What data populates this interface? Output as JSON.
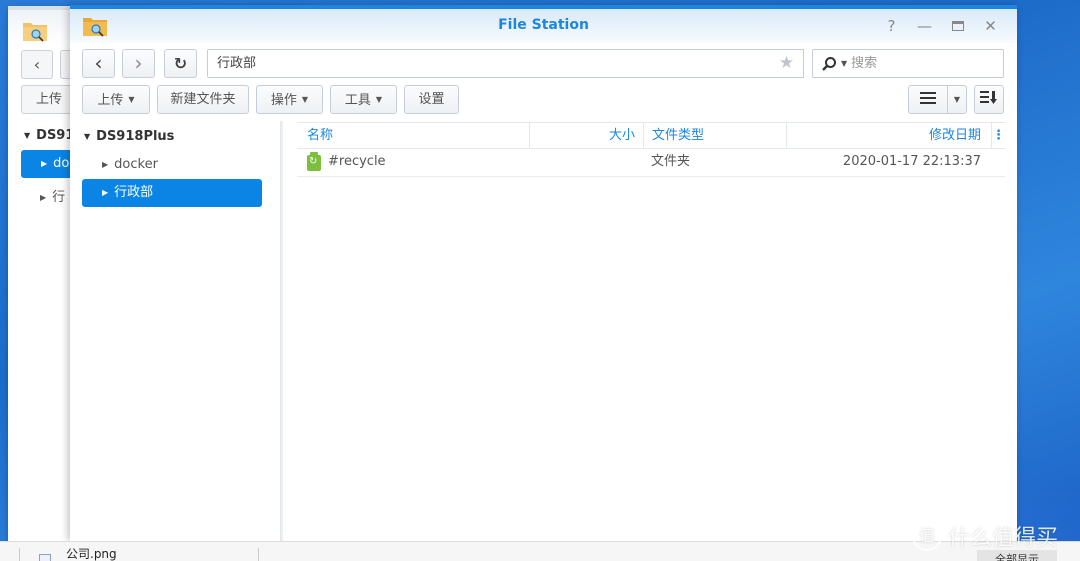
{
  "background_window": {
    "upload_label": "上传",
    "tree_root": "DS91",
    "selected_item": "do",
    "item": "行"
  },
  "window": {
    "title": "File Station",
    "controls": {
      "help": "?",
      "minimize": "—",
      "maximize": "▭",
      "close": "✕"
    }
  },
  "navigation": {
    "back": "‹",
    "forward": "›",
    "refresh": "↻",
    "path": "行政部",
    "favorite": "★",
    "search_placeholder": "搜索"
  },
  "toolbar": {
    "upload": "上传",
    "new_folder": "新建文件夹",
    "action": "操作",
    "tools": "工具",
    "settings": "设置",
    "view_list": "≡",
    "view_dropdown": "▾",
    "sort": "☰↓"
  },
  "sidebar": {
    "root": "DS918Plus",
    "items": [
      {
        "label": "docker",
        "selected": false
      },
      {
        "label": "行政部",
        "selected": true
      }
    ]
  },
  "file_list": {
    "columns": {
      "name": "名称",
      "size": "大小",
      "type": "文件类型",
      "modified": "修改日期",
      "more": "⋮"
    },
    "rows": [
      {
        "name": "#recycle",
        "size": "",
        "type": "文件夹",
        "modified": "2020-01-17 22:13:37",
        "icon": "recycle-bin-icon"
      }
    ]
  },
  "bottom_bar": {
    "file_name": "公司.png",
    "show_all": "全部显示"
  },
  "watermark": {
    "symbol": "值",
    "text": "什么值得买"
  }
}
